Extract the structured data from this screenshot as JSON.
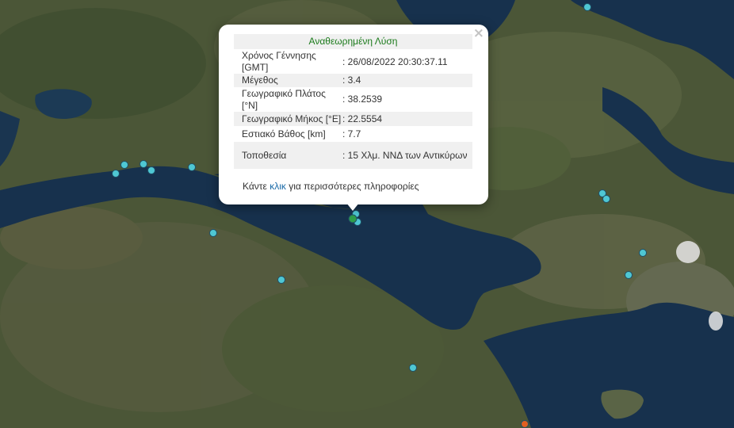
{
  "popup": {
    "title": "Αναθεωρημένη Λύση",
    "close_glyph": "×",
    "rows": [
      {
        "label": "Χρόνος Γέννησης [GMT]",
        "value": ": 26/08/2022 20:30:37.11"
      },
      {
        "label": "Μέγεθος",
        "value": ": 3.4"
      },
      {
        "label": "Γεωγραφικό Πλάτος [°N]",
        "value": ": 38.2539"
      },
      {
        "label": "Γεωγραφικό Μήκος [°E]",
        "value": ": 22.5554"
      },
      {
        "label": "Εστιακό Βάθος [km]",
        "value": ": 7.7"
      },
      {
        "label": "Τοποθεσία",
        "value": ": 15 Χλμ. ΝΝΔ των Αντικύρων"
      }
    ],
    "more_prefix": "Κάντε ",
    "more_link": "κλικ",
    "more_suffix": " για περισσότερες πληροφορίες"
  },
  "colors": {
    "marker_fill": "#4fc7d3",
    "marker_stroke": "#1f4f66",
    "selected_marker": "#2e9e4a",
    "recent_marker": "#e06020",
    "sea": "#17314d",
    "land": "#4a5638"
  },
  "markers": [
    {
      "id": "eq-1",
      "type": "normal"
    },
    {
      "id": "eq-2",
      "type": "normal"
    },
    {
      "id": "eq-3",
      "type": "normal"
    },
    {
      "id": "eq-4",
      "type": "normal"
    },
    {
      "id": "eq-5",
      "type": "normal"
    },
    {
      "id": "eq-6",
      "type": "normal"
    },
    {
      "id": "eq-7",
      "type": "normal"
    },
    {
      "id": "eq-8",
      "type": "normal"
    },
    {
      "id": "eq-9",
      "type": "normal"
    },
    {
      "id": "eq-10",
      "type": "normal"
    },
    {
      "id": "eq-11",
      "type": "normal"
    },
    {
      "id": "eq-12",
      "type": "normal"
    },
    {
      "id": "eq-13",
      "type": "normal"
    },
    {
      "id": "eq-14",
      "type": "normal"
    },
    {
      "id": "eq-15",
      "type": "normal"
    },
    {
      "id": "eq-selected",
      "type": "selected"
    },
    {
      "id": "eq-16",
      "type": "recent"
    }
  ]
}
